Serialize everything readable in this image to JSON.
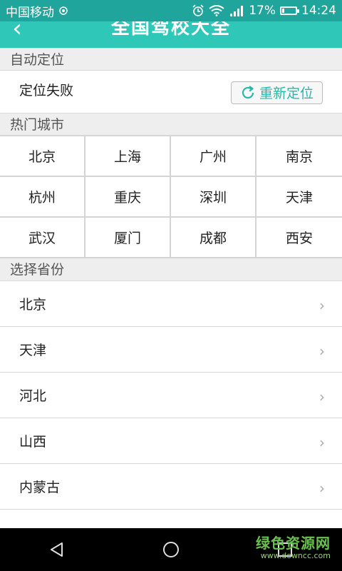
{
  "status_bar": {
    "carrier": "中国移动",
    "battery": "17%",
    "battery_level": 0.17,
    "time": "14:24",
    "icons": [
      "signal-broadcast-icon",
      "alarm-icon",
      "wifi-icon",
      "cellular-signal-icon",
      "battery-icon"
    ]
  },
  "header": {
    "title": "全国驾校大全",
    "back_icon": "back-arrow-icon"
  },
  "auto_location": {
    "section_title": "自动定位",
    "status_text": "定位失败",
    "relocate_label": "重新定位",
    "relocate_icon": "refresh-icon",
    "accent_color": "#26b9a9"
  },
  "hot_cities": {
    "section_title": "热门城市",
    "cities": [
      "北京",
      "上海",
      "广州",
      "南京",
      "杭州",
      "重庆",
      "深圳",
      "天津",
      "武汉",
      "厦门",
      "成都",
      "西安"
    ]
  },
  "provinces": {
    "section_title": "选择省份",
    "items": [
      "北京",
      "天津",
      "河北",
      "山西",
      "内蒙古"
    ],
    "item_icon": "chevron-right-icon"
  },
  "nav_bar": {
    "buttons": [
      "back-triangle-icon",
      "home-circle-icon",
      "recents-square-icon"
    ]
  },
  "watermark": {
    "text": "绿色资源网",
    "url": "www.downcc.com"
  },
  "colors": {
    "status_bar": "#1fa59c",
    "header": "#2ec7b8",
    "section_bg": "#eeeeee"
  }
}
